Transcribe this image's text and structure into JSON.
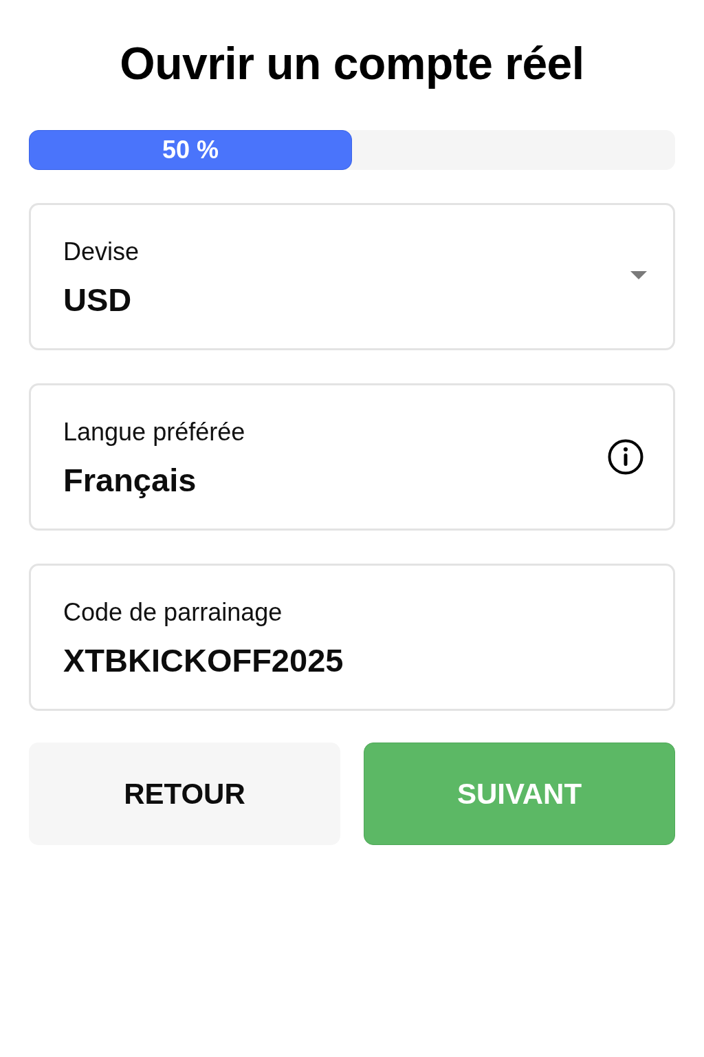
{
  "title": "Ouvrir un compte réel",
  "progress": {
    "level": 0.5,
    "reading": "50 %"
  },
  "fields": [
    {
      "kind": "select",
      "label": "Devise",
      "value": "USD"
    },
    {
      "kind": "info",
      "label": "Langue préférée",
      "value": "Français"
    },
    {
      "kind": "text",
      "label": "Code de parrainage",
      "value": "XTBKICKOFF2025"
    }
  ],
  "buttons": [
    {
      "kind": "secondary",
      "label": "RETOUR"
    },
    {
      "kind": "primary",
      "label": "SUIVANT"
    }
  ]
}
